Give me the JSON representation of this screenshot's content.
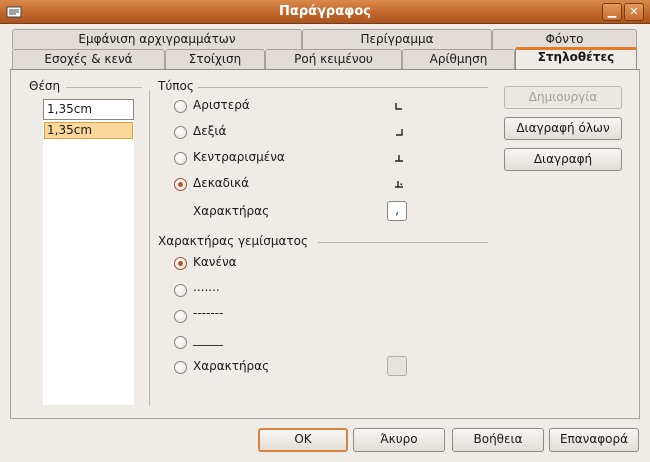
{
  "window": {
    "title": "Παράγραφος"
  },
  "tabs_row1": [
    "Εμφάνιση αρχιγραμμάτων",
    "Περίγραμμα",
    "Φόντο"
  ],
  "tabs_row2": [
    "Εσοχές & κενά",
    "Στοίχιση",
    "Ροή κειμένου",
    "Αρίθμηση",
    "Στηλοθέτες"
  ],
  "position": {
    "label": "Θέση",
    "value": "1,35cm",
    "list": [
      "1,35cm"
    ]
  },
  "type": {
    "label": "Τύπος",
    "options": [
      {
        "label": "Αριστερά",
        "checked": false
      },
      {
        "label": "Δεξιά",
        "checked": false
      },
      {
        "label": "Κεντραρισμένα",
        "checked": false
      },
      {
        "label": "Δεκαδικά",
        "checked": true
      }
    ],
    "char_label": "Χαρακτήρας",
    "char_value": ","
  },
  "fill": {
    "label": "Χαρακτήρας γεμίσματος",
    "options": [
      {
        "label": "Κανένα",
        "checked": true
      },
      {
        "label": ".......",
        "checked": false
      },
      {
        "label": "-------",
        "checked": false
      },
      {
        "label": "_____",
        "checked": false
      },
      {
        "label": "Χαρακτήρας",
        "checked": false
      }
    ]
  },
  "side_buttons": {
    "new": "Δημιουργία",
    "delete_all": "Διαγραφή όλων",
    "delete": "Διαγραφή"
  },
  "bottom_buttons": {
    "ok": "OK",
    "cancel": "Άκυρο",
    "help": "Βοήθεια",
    "reset": "Επαναφορά"
  },
  "colors": {
    "accent": "#e07b2a",
    "titlebar": "#c0652a",
    "selection": "#fbd89a"
  }
}
